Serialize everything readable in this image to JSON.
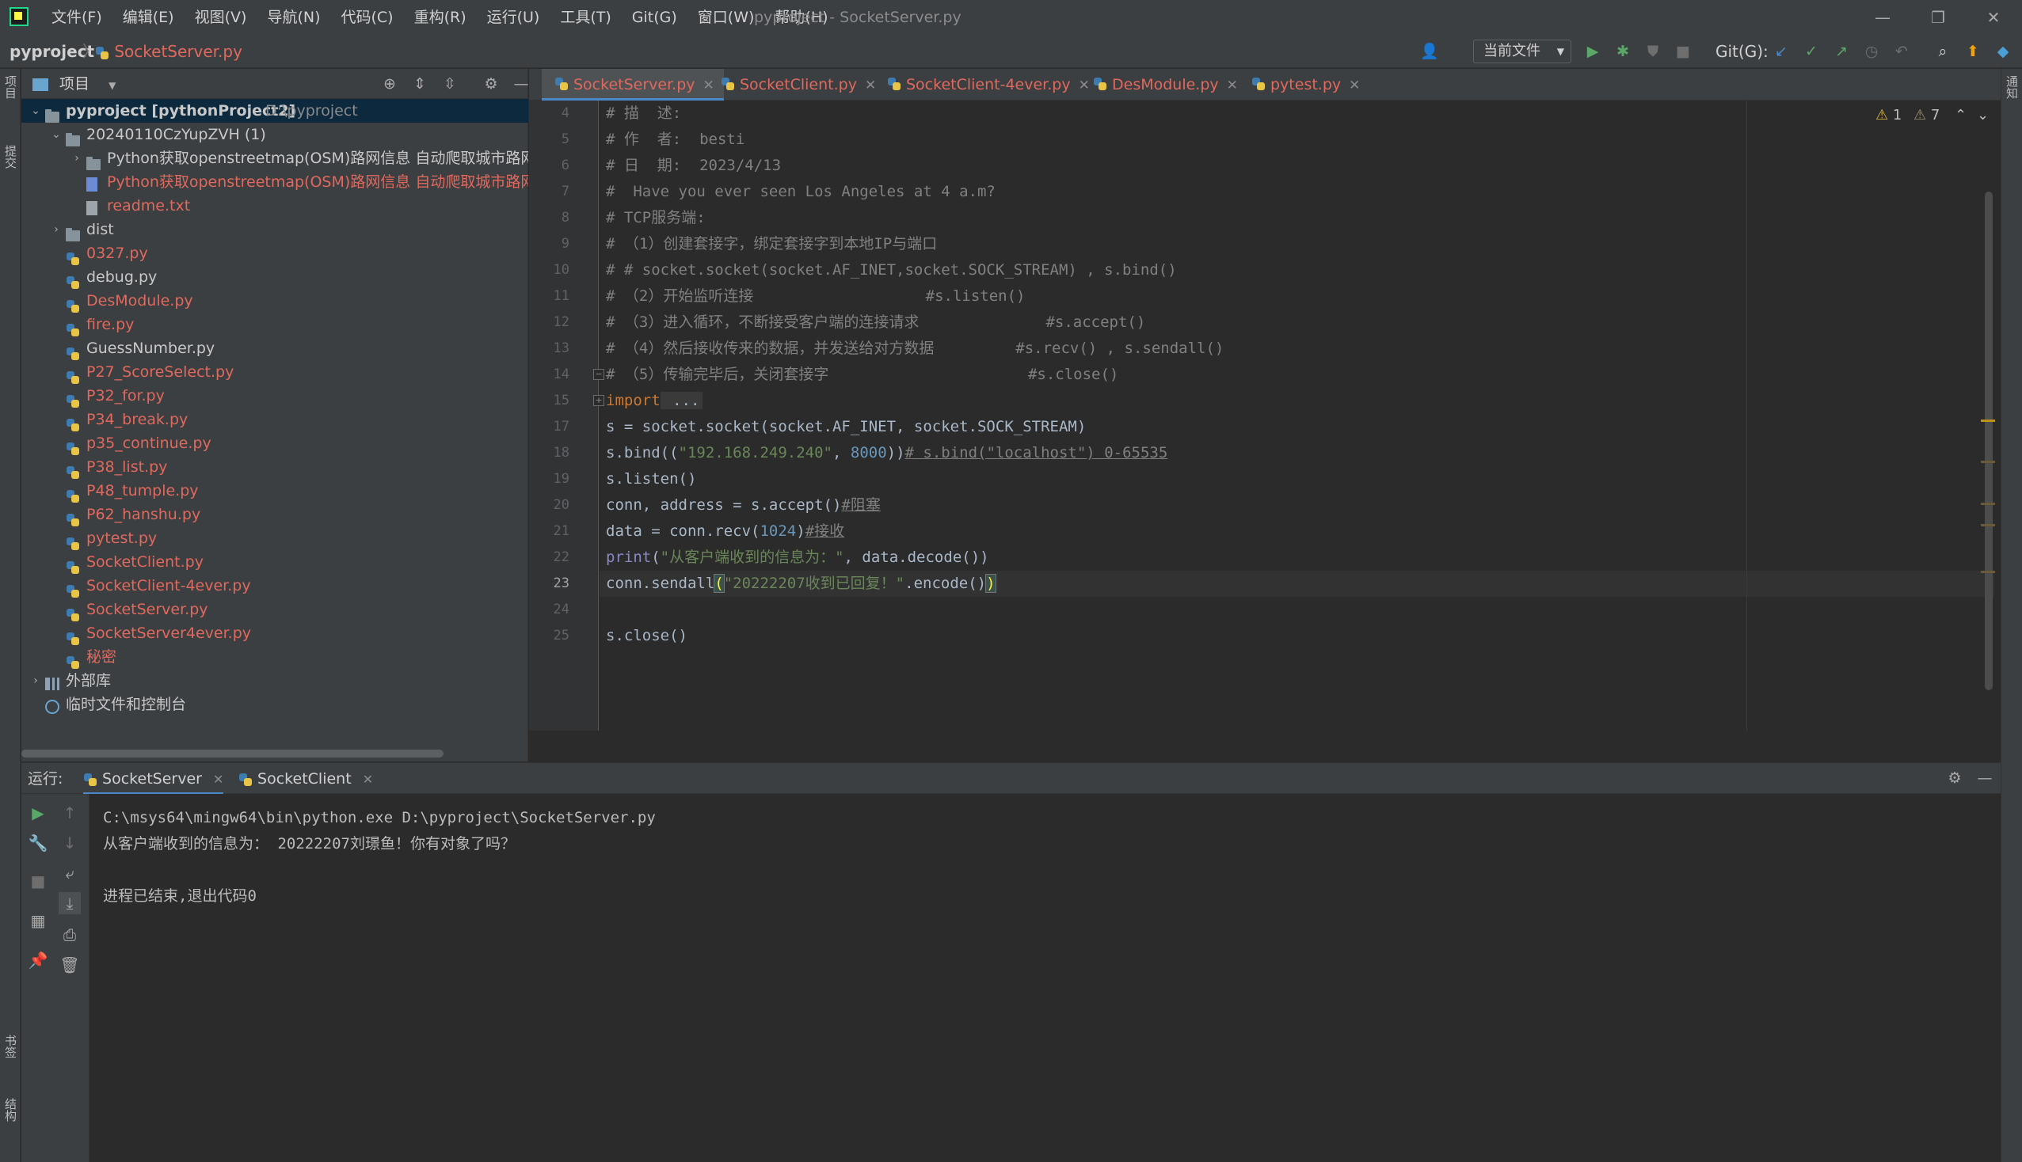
{
  "titlebar": {
    "menus": [
      "文件(F)",
      "编辑(E)",
      "视图(V)",
      "导航(N)",
      "代码(C)",
      "重构(R)",
      "运行(U)",
      "工具(T)",
      "Git(G)",
      "窗口(W)",
      "帮助(H)"
    ],
    "window_title": "pyproject - SocketServer.py",
    "minimize": "—",
    "restore": "❐",
    "close": "✕"
  },
  "navbar": {
    "project": "pyproject",
    "separator": "〉",
    "file": "SocketServer.py",
    "run_config": "当前文件",
    "git_label": "Git(G):"
  },
  "side_tabs": {
    "project": "项目",
    "commit": "提交",
    "bookmarks": "书签",
    "structure": "结构",
    "notifications": "通知"
  },
  "project_panel": {
    "title": "项目",
    "tree": [
      {
        "label": "pyproject [pythonProject2]",
        "suffix": "D:\\pyproject",
        "type": "folder",
        "depth": 0,
        "expanded": true,
        "style": "normal",
        "selected": true
      },
      {
        "label": "20240110CzYupZVH (1)",
        "type": "folder",
        "depth": 1,
        "expanded": true,
        "style": "normal"
      },
      {
        "label": "Python获取openstreetmap(OSM)路网信息 自动爬取城市路网",
        "type": "folder",
        "depth": 2,
        "expanded": false,
        "style": "normal"
      },
      {
        "label": "Python获取openstreetmap(OSM)路网信息 自动爬取城市路网",
        "type": "html",
        "depth": 2,
        "style": "red"
      },
      {
        "label": "readme.txt",
        "type": "txt",
        "depth": 2,
        "style": "red"
      },
      {
        "label": "dist",
        "type": "folder",
        "depth": 1,
        "expanded": false,
        "style": "normal"
      },
      {
        "label": "0327.py",
        "type": "py",
        "depth": 1,
        "style": "red"
      },
      {
        "label": "debug.py",
        "type": "py",
        "depth": 1,
        "style": "normal"
      },
      {
        "label": "DesModule.py",
        "type": "py",
        "depth": 1,
        "style": "red"
      },
      {
        "label": "fire.py",
        "type": "py",
        "depth": 1,
        "style": "red"
      },
      {
        "label": "GuessNumber.py",
        "type": "py",
        "depth": 1,
        "style": "normal"
      },
      {
        "label": "P27_ScoreSelect.py",
        "type": "py",
        "depth": 1,
        "style": "red"
      },
      {
        "label": "P32_for.py",
        "type": "py",
        "depth": 1,
        "style": "red"
      },
      {
        "label": "P34_break.py",
        "type": "py",
        "depth": 1,
        "style": "red"
      },
      {
        "label": "p35_continue.py",
        "type": "py",
        "depth": 1,
        "style": "red"
      },
      {
        "label": "P38_list.py",
        "type": "py",
        "depth": 1,
        "style": "red"
      },
      {
        "label": "P48_tumple.py",
        "type": "py",
        "depth": 1,
        "style": "red"
      },
      {
        "label": "P62_hanshu.py",
        "type": "py",
        "depth": 1,
        "style": "red"
      },
      {
        "label": "pytest.py",
        "type": "py",
        "depth": 1,
        "style": "red"
      },
      {
        "label": "SocketClient.py",
        "type": "py",
        "depth": 1,
        "style": "red"
      },
      {
        "label": "SocketClient-4ever.py",
        "type": "py",
        "depth": 1,
        "style": "red"
      },
      {
        "label": "SocketServer.py",
        "type": "py",
        "depth": 1,
        "style": "red"
      },
      {
        "label": "SocketServer4ever.py",
        "type": "py",
        "depth": 1,
        "style": "red"
      },
      {
        "label": "秘密",
        "type": "py",
        "depth": 1,
        "style": "red"
      },
      {
        "label": "外部库",
        "type": "lib",
        "depth": 0,
        "expanded": false,
        "style": "normal"
      },
      {
        "label": "临时文件和控制台",
        "type": "scratch",
        "depth": 0,
        "style": "normal"
      }
    ]
  },
  "editor_tabs": [
    {
      "label": "SocketServer.py",
      "active": true
    },
    {
      "label": "SocketClient.py",
      "active": false
    },
    {
      "label": "SocketClient-4ever.py",
      "active": false
    },
    {
      "label": "DesModule.py",
      "active": false
    },
    {
      "label": "pytest.py",
      "active": false
    }
  ],
  "inspections": {
    "warnings": "1",
    "weak_warnings": "7"
  },
  "editor": {
    "current_line": "23",
    "lines": [
      {
        "n": "4",
        "parts": [
          [
            "cmt",
            "# 描  述:"
          ]
        ]
      },
      {
        "n": "5",
        "parts": [
          [
            "cmt",
            "# 作  者:  besti"
          ]
        ]
      },
      {
        "n": "6",
        "parts": [
          [
            "cmt",
            "# 日  期:  2023/4/13"
          ]
        ]
      },
      {
        "n": "7",
        "parts": [
          [
            "cmt",
            "#  Have you ever seen Los Angeles at 4 a.m?"
          ]
        ]
      },
      {
        "n": "8",
        "parts": [
          [
            "cmt",
            "# TCP服务端:"
          ]
        ]
      },
      {
        "n": "9",
        "parts": [
          [
            "cmt",
            "# （1）创建套接字，绑定套接字到本地IP与端口"
          ]
        ]
      },
      {
        "n": "10",
        "parts": [
          [
            "cmt",
            "# # socket.socket(socket.AF_INET,socket.SOCK_STREAM) , s.bind()"
          ]
        ]
      },
      {
        "n": "11",
        "parts": [
          [
            "cmt",
            "# （2）开始监听连接                   #s.listen()"
          ]
        ]
      },
      {
        "n": "12",
        "parts": [
          [
            "cmt",
            "# （3）进入循环，不断接受客户端的连接请求              #s.accept()"
          ]
        ]
      },
      {
        "n": "13",
        "parts": [
          [
            "cmt",
            "# （4）然后接收传来的数据，并发送给对方数据         #s.recv() , s.sendall()"
          ]
        ]
      },
      {
        "n": "14",
        "parts": [
          [
            "cmt",
            "# （5）传输完毕后，关闭套接字                      #s.close()"
          ]
        ]
      },
      {
        "n": "15",
        "parts": [
          [
            "kw",
            "import"
          ],
          [
            "folded",
            " ..."
          ]
        ]
      },
      {
        "n": "17",
        "parts": [
          [
            "txt",
            "s = socket.socket(socket.AF_INET, socket.SOCK_STREAM)"
          ]
        ]
      },
      {
        "n": "18",
        "parts": [
          [
            "txt",
            "s.bind(("
          ],
          [
            "str",
            "\"192.168.249.240\""
          ],
          [
            "txt",
            ", "
          ],
          [
            "num",
            "8000"
          ],
          [
            "txt",
            "))"
          ],
          [
            "cmt-u",
            "# s.bind(\"localhost\") 0-65535"
          ]
        ]
      },
      {
        "n": "19",
        "parts": [
          [
            "txt",
            "s.listen()"
          ]
        ]
      },
      {
        "n": "20",
        "parts": [
          [
            "txt",
            "conn, address = s.accept()"
          ],
          [
            "cmt-u",
            "#阻塞"
          ]
        ]
      },
      {
        "n": "21",
        "parts": [
          [
            "txt",
            "data = conn.recv("
          ],
          [
            "num",
            "1024"
          ],
          [
            "txt",
            ")"
          ],
          [
            "cmt-u",
            "#接收"
          ]
        ]
      },
      {
        "n": "22",
        "parts": [
          [
            "builtin",
            "print"
          ],
          [
            "txt",
            "("
          ],
          [
            "str",
            "\"从客户端收到的信息为：\""
          ],
          [
            "txt",
            ", data.decode())"
          ]
        ]
      },
      {
        "n": "23",
        "parts": [
          [
            "txt",
            "conn.sendall"
          ],
          [
            "bracket",
            "("
          ],
          [
            "str",
            "\"20222207收到已回复！\""
          ],
          [
            "txt",
            ".encode()"
          ],
          [
            "bracket",
            ")"
          ]
        ]
      },
      {
        "n": "24",
        "parts": []
      },
      {
        "n": "25",
        "parts": [
          [
            "txt",
            "s.close()"
          ]
        ]
      }
    ]
  },
  "run_panel": {
    "label": "运行:",
    "tabs": [
      {
        "label": "SocketServer",
        "active": true
      },
      {
        "label": "SocketClient",
        "active": false
      }
    ],
    "console": [
      "C:\\msys64\\mingw64\\bin\\python.exe D:\\pyproject\\SocketServer.py",
      "从客户端收到的信息为： 20222207刘璟鱼！你有对象了吗？",
      "",
      "进程已结束,退出代码0"
    ]
  },
  "colors": {
    "accent": "#4a88c7",
    "modified_file": "#e0695e",
    "comment": "#808080",
    "string": "#6a8759",
    "number": "#6897bb"
  }
}
